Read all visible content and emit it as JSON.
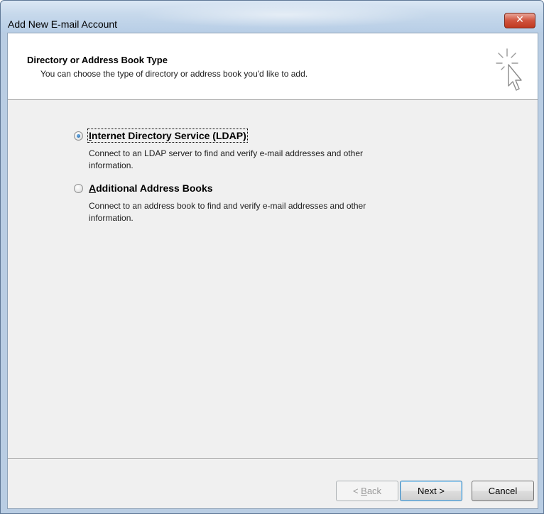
{
  "window": {
    "title": "Add New E-mail Account",
    "close_glyph": "✕"
  },
  "header": {
    "title": "Directory or Address Book Type",
    "subtitle": "You can choose the type of directory or address book you'd like to add.",
    "icon": "wizard-cursor-icon"
  },
  "options": [
    {
      "label_access": "I",
      "label_rest": "nternet Directory Service (LDAP)",
      "description": "Connect to an LDAP server to find and verify e-mail addresses and other information.",
      "selected": true
    },
    {
      "label_access": "A",
      "label_rest": "dditional Address Books",
      "description": "Connect to an address book to find and verify e-mail addresses and other information.",
      "selected": false
    }
  ],
  "buttons": {
    "back_prefix": "< ",
    "back_access": "B",
    "back_rest": "ack",
    "next": "Next >",
    "cancel": "Cancel"
  },
  "colors": {
    "close_button": "#c0391f",
    "frame": "#b9cde3",
    "radio_dot": "#1b5e9e"
  }
}
